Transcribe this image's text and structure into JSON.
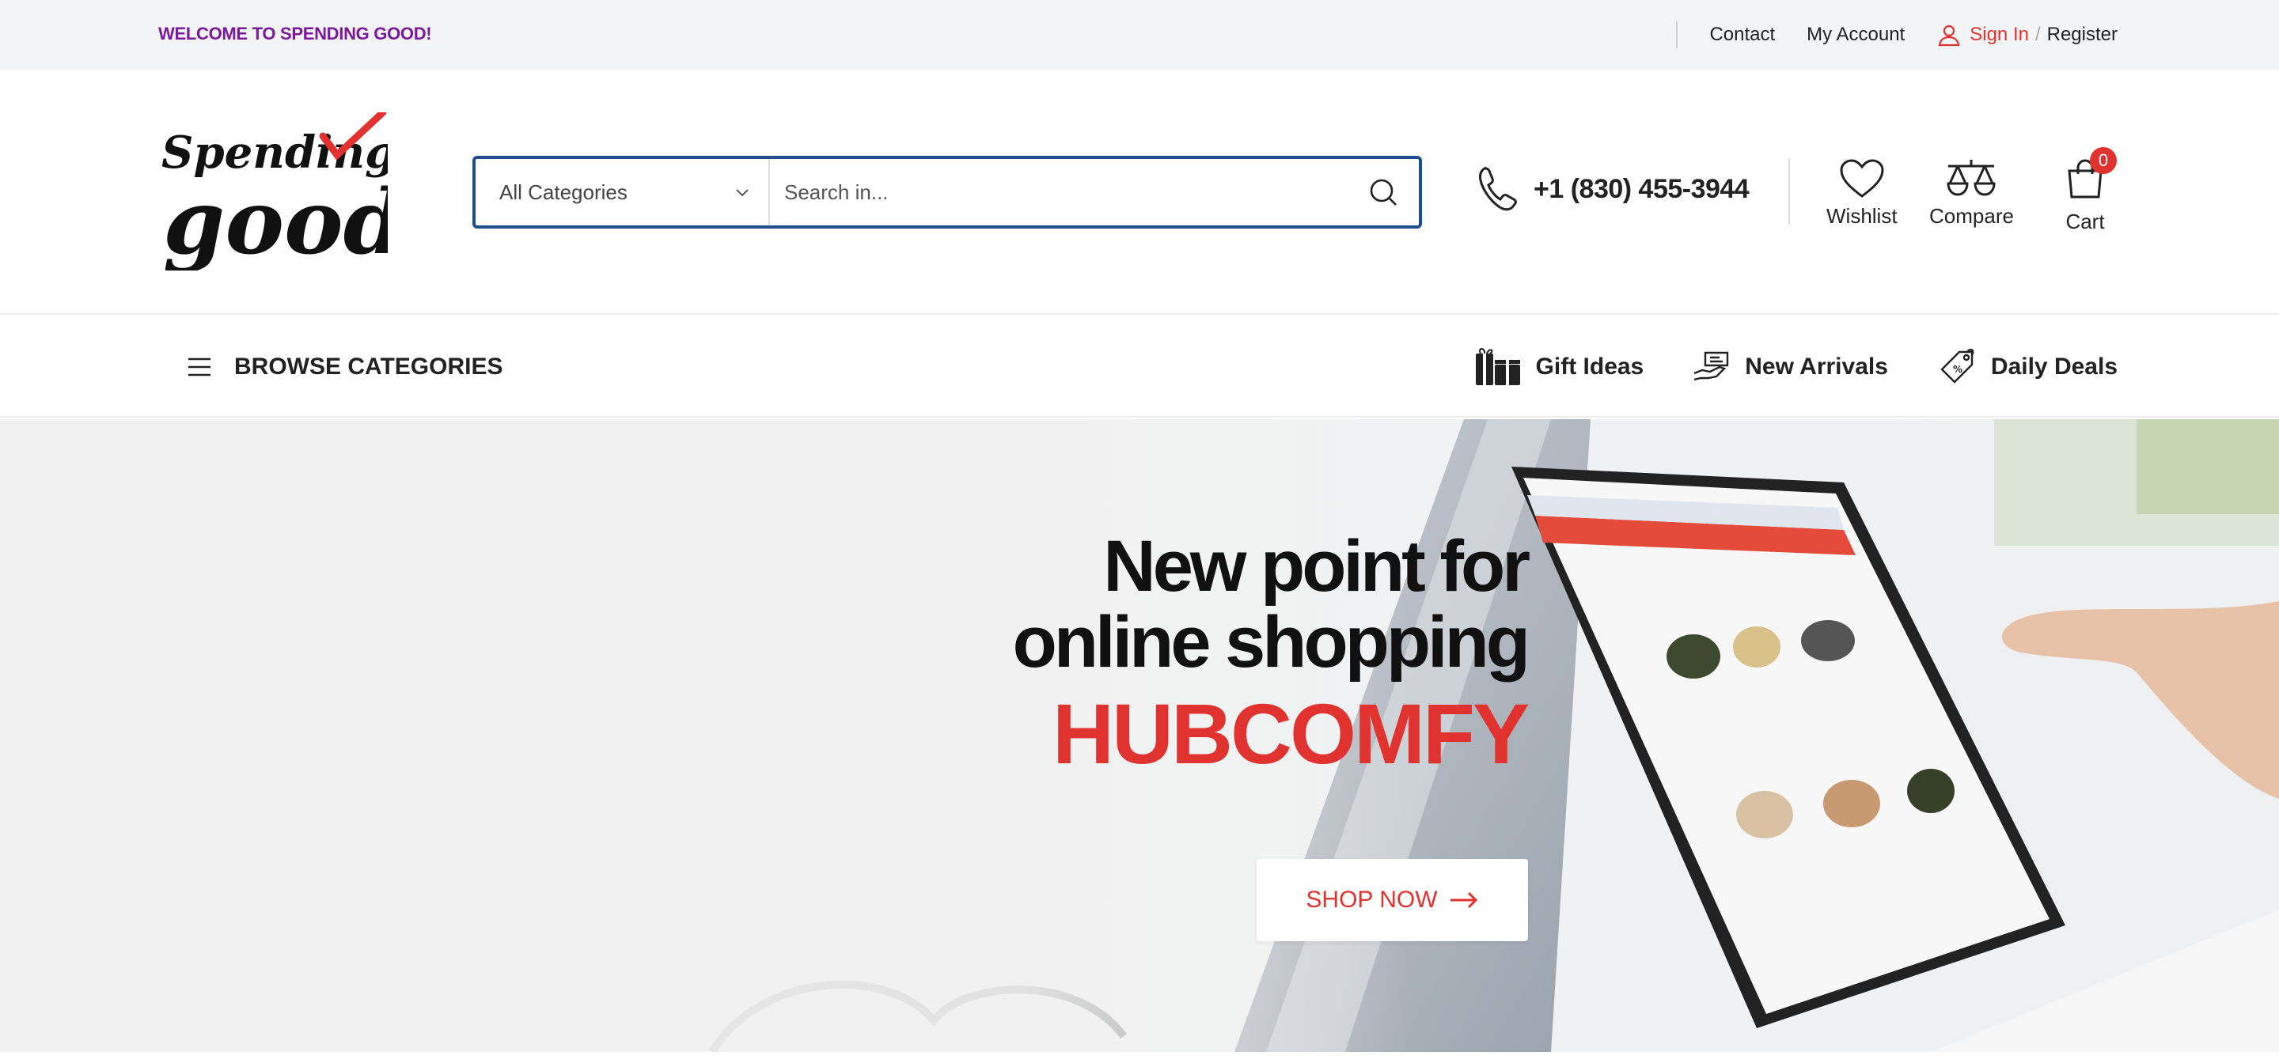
{
  "topbar": {
    "welcome": "WELCOME TO SPENDING GOOD!",
    "links": [
      "Contact",
      "My Account"
    ],
    "sign_in": "Sign In",
    "slash": "/",
    "register": "Register"
  },
  "header": {
    "logo_text_top": "Spending",
    "logo_text_bottom": "good",
    "search": {
      "category": "All Categories",
      "placeholder": "Search in..."
    },
    "phone": "+1 (830) 455-3944",
    "wishlist": "Wishlist",
    "compare": "Compare",
    "cart": "Cart",
    "cart_count": "0"
  },
  "navbar": {
    "browse": "BROWSE CATEGORIES",
    "links": [
      "Gift Ideas",
      "New Arrivals",
      "Daily Deals"
    ]
  },
  "hero": {
    "line1": "New point for",
    "line2": "online shopping",
    "brand": "HUBCOMFY",
    "button": "SHOP NOW"
  },
  "colors": {
    "accent": "#e0322f",
    "welcome": "#7a1a9a",
    "search_border": "#1f4e8c"
  }
}
